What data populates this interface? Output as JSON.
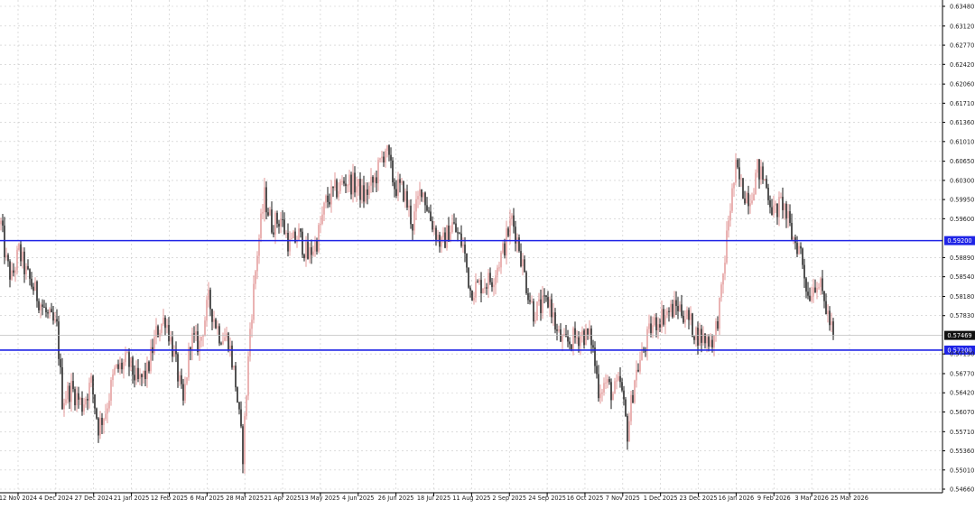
{
  "chart_data": {
    "type": "candlestick",
    "title": "",
    "xlabel": "",
    "ylabel": "",
    "ylim": [
      0.5466,
      0.6348
    ],
    "grid": true,
    "y_ticks": [
      "0.63480",
      "0.63120",
      "0.62770",
      "0.62420",
      "0.62060",
      "0.61710",
      "0.61360",
      "0.61010",
      "0.60650",
      "0.60300",
      "0.59950",
      "0.59600",
      "0.58890",
      "0.58540",
      "0.58180",
      "0.57830",
      "0.57130",
      "0.56770",
      "0.56420",
      "0.56070",
      "0.55710",
      "0.55360",
      "0.55010",
      "0.54660"
    ],
    "x_ticks": [
      "12 Nov 2024",
      "4 Dec 2024",
      "27 Dec 2024",
      "21 Jan 2025",
      "12 Feb 2025",
      "6 Mar 2025",
      "28 Mar 2025",
      "21 Apr 2025",
      "13 May 2025",
      "4 Jun 2025",
      "26 Jun 2025",
      "18 Jul 2025",
      "11 Aug 2025",
      "2 Sep 2025",
      "24 Sep 2025",
      "16 Oct 2025",
      "7 Nov 2025",
      "1 Dec 2025",
      "23 Dec 2025",
      "16 Jan 2026",
      "9 Feb 2026",
      "3 Mar 2026",
      "25 Mar 2026"
    ],
    "levels": [
      {
        "value": 0.592,
        "label": "0.59200",
        "color": "#1f24e6"
      },
      {
        "value": 0.572,
        "label": "0.57200",
        "color": "#1f24e6"
      }
    ],
    "current_price": {
      "value": 0.57469,
      "label": "0.57469"
    },
    "anchors": [
      [
        0,
        0.595
      ],
      [
        6,
        0.588
      ],
      [
        12,
        0.585
      ],
      [
        20,
        0.59
      ],
      [
        28,
        0.586
      ],
      [
        40,
        0.582
      ],
      [
        52,
        0.578
      ],
      [
        62,
        0.576
      ],
      [
        68,
        0.563
      ],
      [
        78,
        0.565
      ],
      [
        90,
        0.562
      ],
      [
        100,
        0.566
      ],
      [
        108,
        0.558
      ],
      [
        116,
        0.561
      ],
      [
        126,
        0.568
      ],
      [
        140,
        0.57
      ],
      [
        152,
        0.566
      ],
      [
        162,
        0.568
      ],
      [
        172,
        0.575
      ],
      [
        182,
        0.578
      ],
      [
        192,
        0.571
      ],
      [
        202,
        0.562
      ],
      [
        210,
        0.574
      ],
      [
        220,
        0.573
      ],
      [
        230,
        0.581
      ],
      [
        242,
        0.575
      ],
      [
        252,
        0.574
      ],
      [
        260,
        0.566
      ],
      [
        268,
        0.553
      ],
      [
        276,
        0.576
      ],
      [
        284,
        0.59
      ],
      [
        292,
        0.6
      ],
      [
        300,
        0.595
      ],
      [
        310,
        0.596
      ],
      [
        320,
        0.591
      ],
      [
        330,
        0.593
      ],
      [
        340,
        0.589
      ],
      [
        350,
        0.592
      ],
      [
        360,
        0.599
      ],
      [
        370,
        0.601
      ],
      [
        382,
        0.603
      ],
      [
        394,
        0.602
      ],
      [
        402,
        0.6
      ],
      [
        414,
        0.603
      ],
      [
        426,
        0.609
      ],
      [
        436,
        0.602
      ],
      [
        446,
        0.601
      ],
      [
        456,
        0.595
      ],
      [
        466,
        0.602
      ],
      [
        476,
        0.596
      ],
      [
        488,
        0.591
      ],
      [
        500,
        0.595
      ],
      [
        512,
        0.591
      ],
      [
        520,
        0.583
      ],
      [
        532,
        0.584
      ],
      [
        544,
        0.585
      ],
      [
        556,
        0.59
      ],
      [
        566,
        0.596
      ],
      [
        574,
        0.591
      ],
      [
        582,
        0.584
      ],
      [
        590,
        0.579
      ],
      [
        600,
        0.58
      ],
      [
        608,
        0.581
      ],
      [
        616,
        0.575
      ],
      [
        624,
        0.573
      ],
      [
        634,
        0.574
      ],
      [
        644,
        0.575
      ],
      [
        654,
        0.574
      ],
      [
        662,
        0.565
      ],
      [
        670,
        0.566
      ],
      [
        678,
        0.564
      ],
      [
        686,
        0.566
      ],
      [
        694,
        0.557
      ],
      [
        702,
        0.567
      ],
      [
        710,
        0.571
      ],
      [
        720,
        0.576
      ],
      [
        730,
        0.578
      ],
      [
        740,
        0.579
      ],
      [
        750,
        0.58
      ],
      [
        760,
        0.578
      ],
      [
        770,
        0.575
      ],
      [
        780,
        0.574
      ],
      [
        790,
        0.574
      ],
      [
        798,
        0.582
      ],
      [
        806,
        0.596
      ],
      [
        814,
        0.605
      ],
      [
        822,
        0.601
      ],
      [
        830,
        0.6
      ],
      [
        838,
        0.605
      ],
      [
        846,
        0.603
      ],
      [
        856,
        0.597
      ],
      [
        866,
        0.599
      ],
      [
        876,
        0.593
      ],
      [
        886,
        0.59
      ],
      [
        894,
        0.582
      ],
      [
        904,
        0.585
      ],
      [
        912,
        0.581
      ],
      [
        918,
        0.577
      ],
      [
        922,
        0.5747
      ]
    ]
  }
}
